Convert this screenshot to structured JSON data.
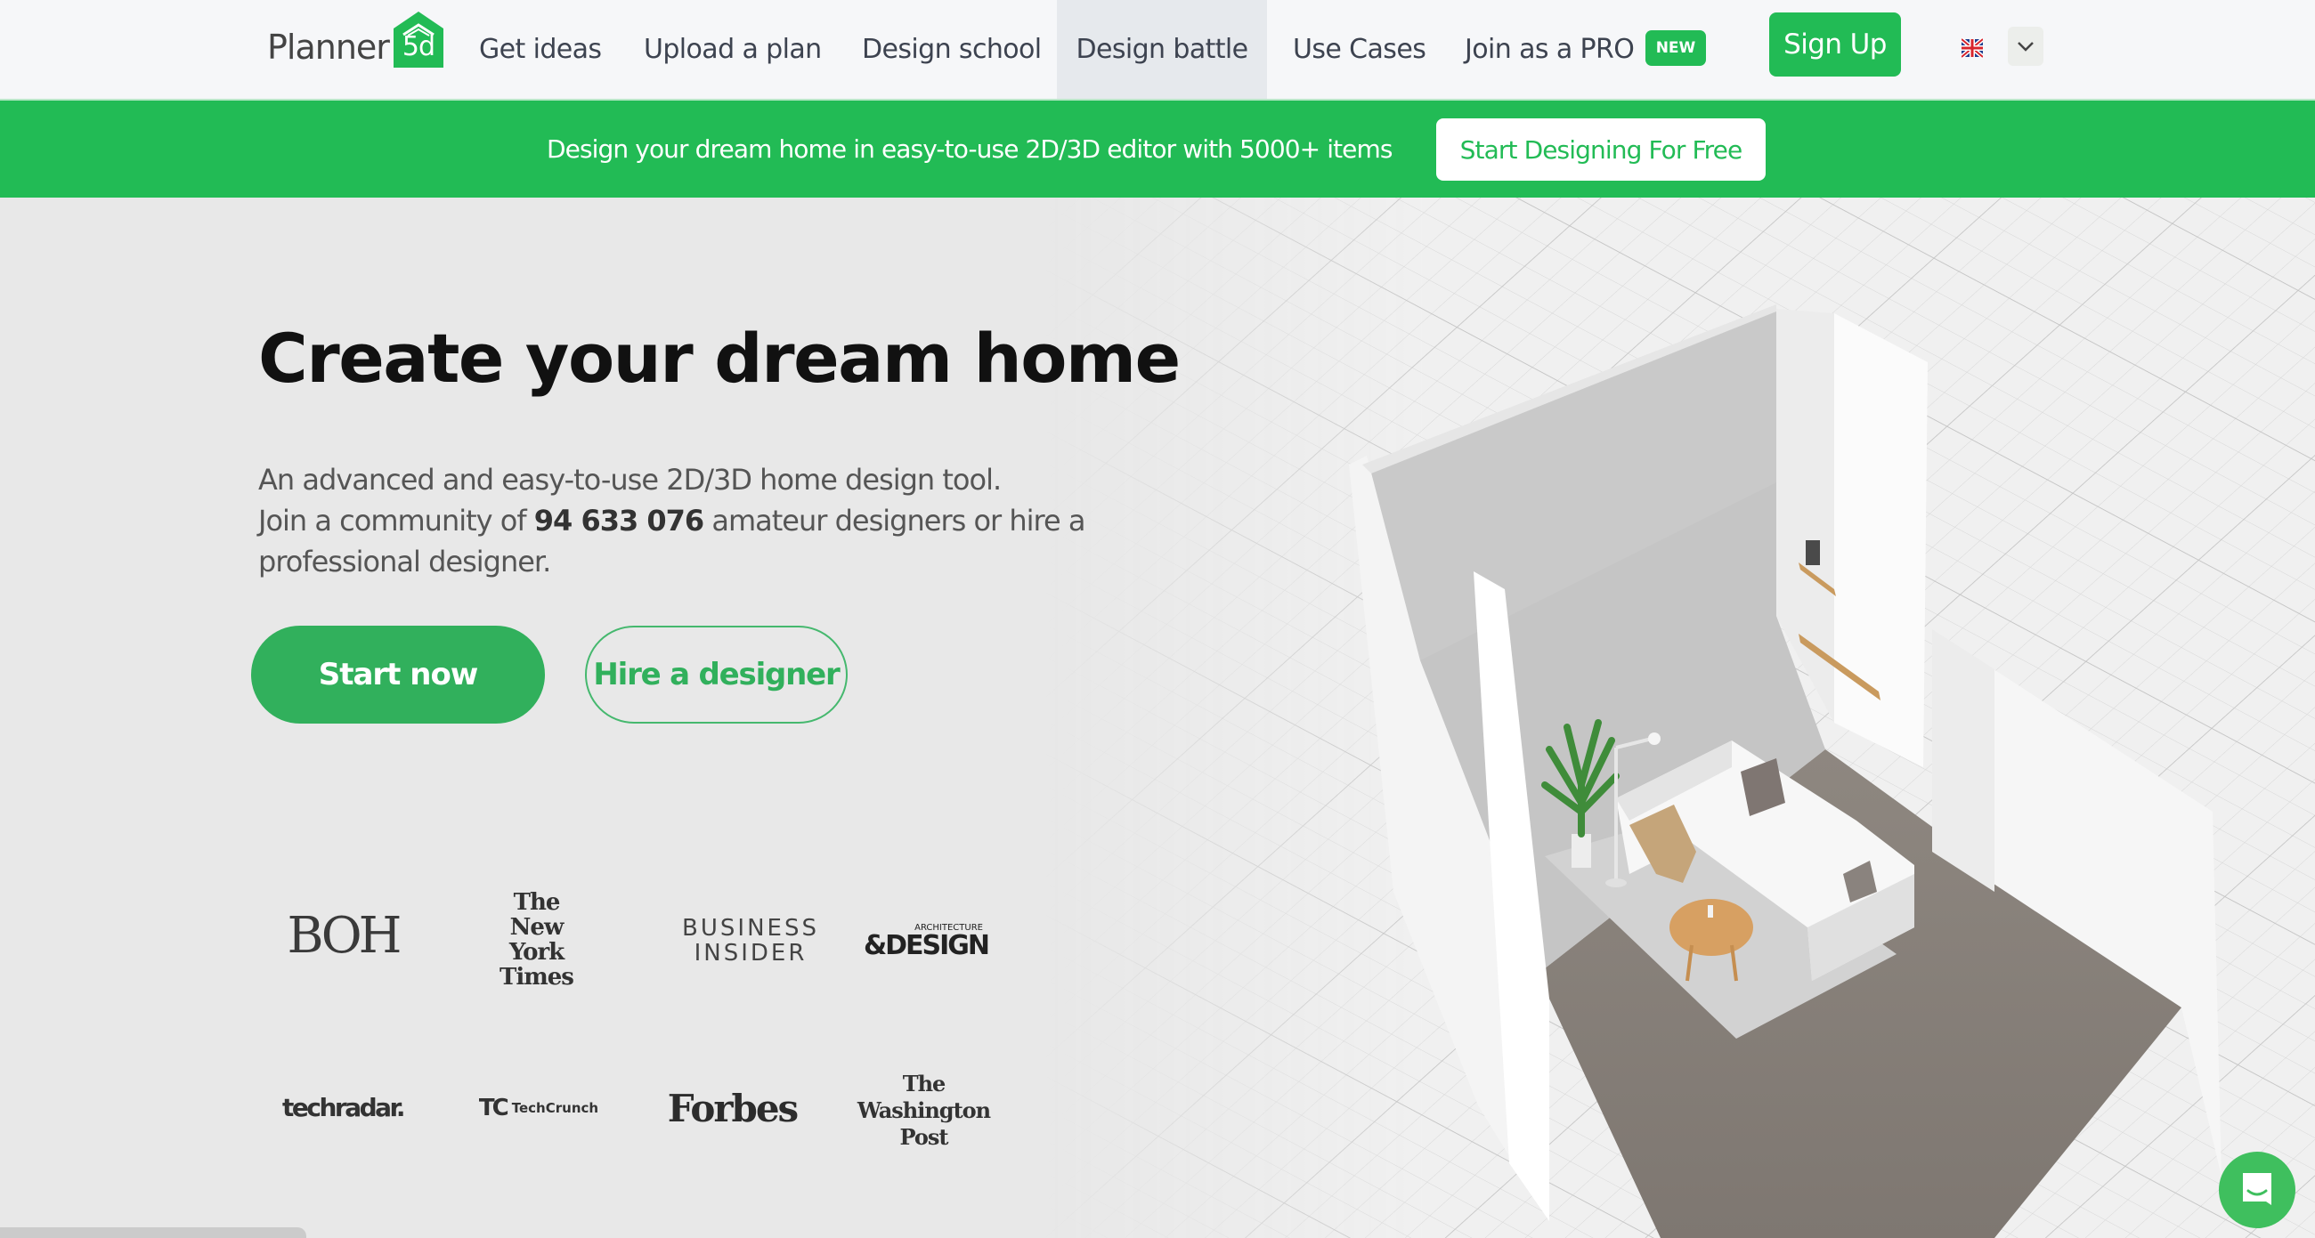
{
  "brand": {
    "logo_word": "Planner",
    "logo_mark": "5d",
    "accent_color": "#22bb55"
  },
  "nav": {
    "links": [
      {
        "label": "Get ideas",
        "active": false
      },
      {
        "label": "Upload a plan",
        "active": false
      },
      {
        "label": "Design school",
        "active": false
      },
      {
        "label": "Design battle",
        "active": true
      },
      {
        "label": "Use Cases",
        "active": false
      },
      {
        "label": "Join as a PRO",
        "active": false
      }
    ],
    "new_badge": "NEW",
    "signup_label": "Sign Up",
    "language_icon": "uk-flag-icon",
    "language_toggle_icon": "chevron-down-icon"
  },
  "banner": {
    "text": "Design your dream home in easy-to-use 2D/3D editor with 5000+ items",
    "cta_label": "Start Designing For Free"
  },
  "hero": {
    "title": "Create your dream home",
    "desc_line1": "An advanced and easy-to-use 2D/3D home design tool.",
    "desc_pre": "Join a community of ",
    "desc_count": "94 633 076",
    "desc_post": " amateur designers or hire a professional designer.",
    "start_label": "Start now",
    "hire_label": "Hire a designer",
    "image_description": "3D isometric room render with sofa, plant, lamp, coffee table and rug on a grid"
  },
  "press": {
    "row1": [
      "BOH",
      "The New York Times",
      "BUSINESS INSIDER",
      "ARCHITECTURE & DESIGN"
    ],
    "row2": [
      "techradar.",
      "TechCrunch",
      "Forbes",
      "The Washington Post"
    ],
    "boh": "BOH",
    "nyt_l1": "The",
    "nyt_l2": "New York",
    "nyt_l3": "Times",
    "bi_l1": "BUSINESS",
    "bi_l2": "INSIDER",
    "ad_small": "ARCHITECTURE",
    "ad_big": "&DESIGN",
    "techradar": "techradar.",
    "tc_mark": "TC",
    "tc_word": "TechCrunch",
    "forbes": "Forbes",
    "wp_l1": "The",
    "wp_l2": "Washington",
    "wp_l3": "Post"
  },
  "chat": {
    "icon": "chat-bubble-icon"
  }
}
